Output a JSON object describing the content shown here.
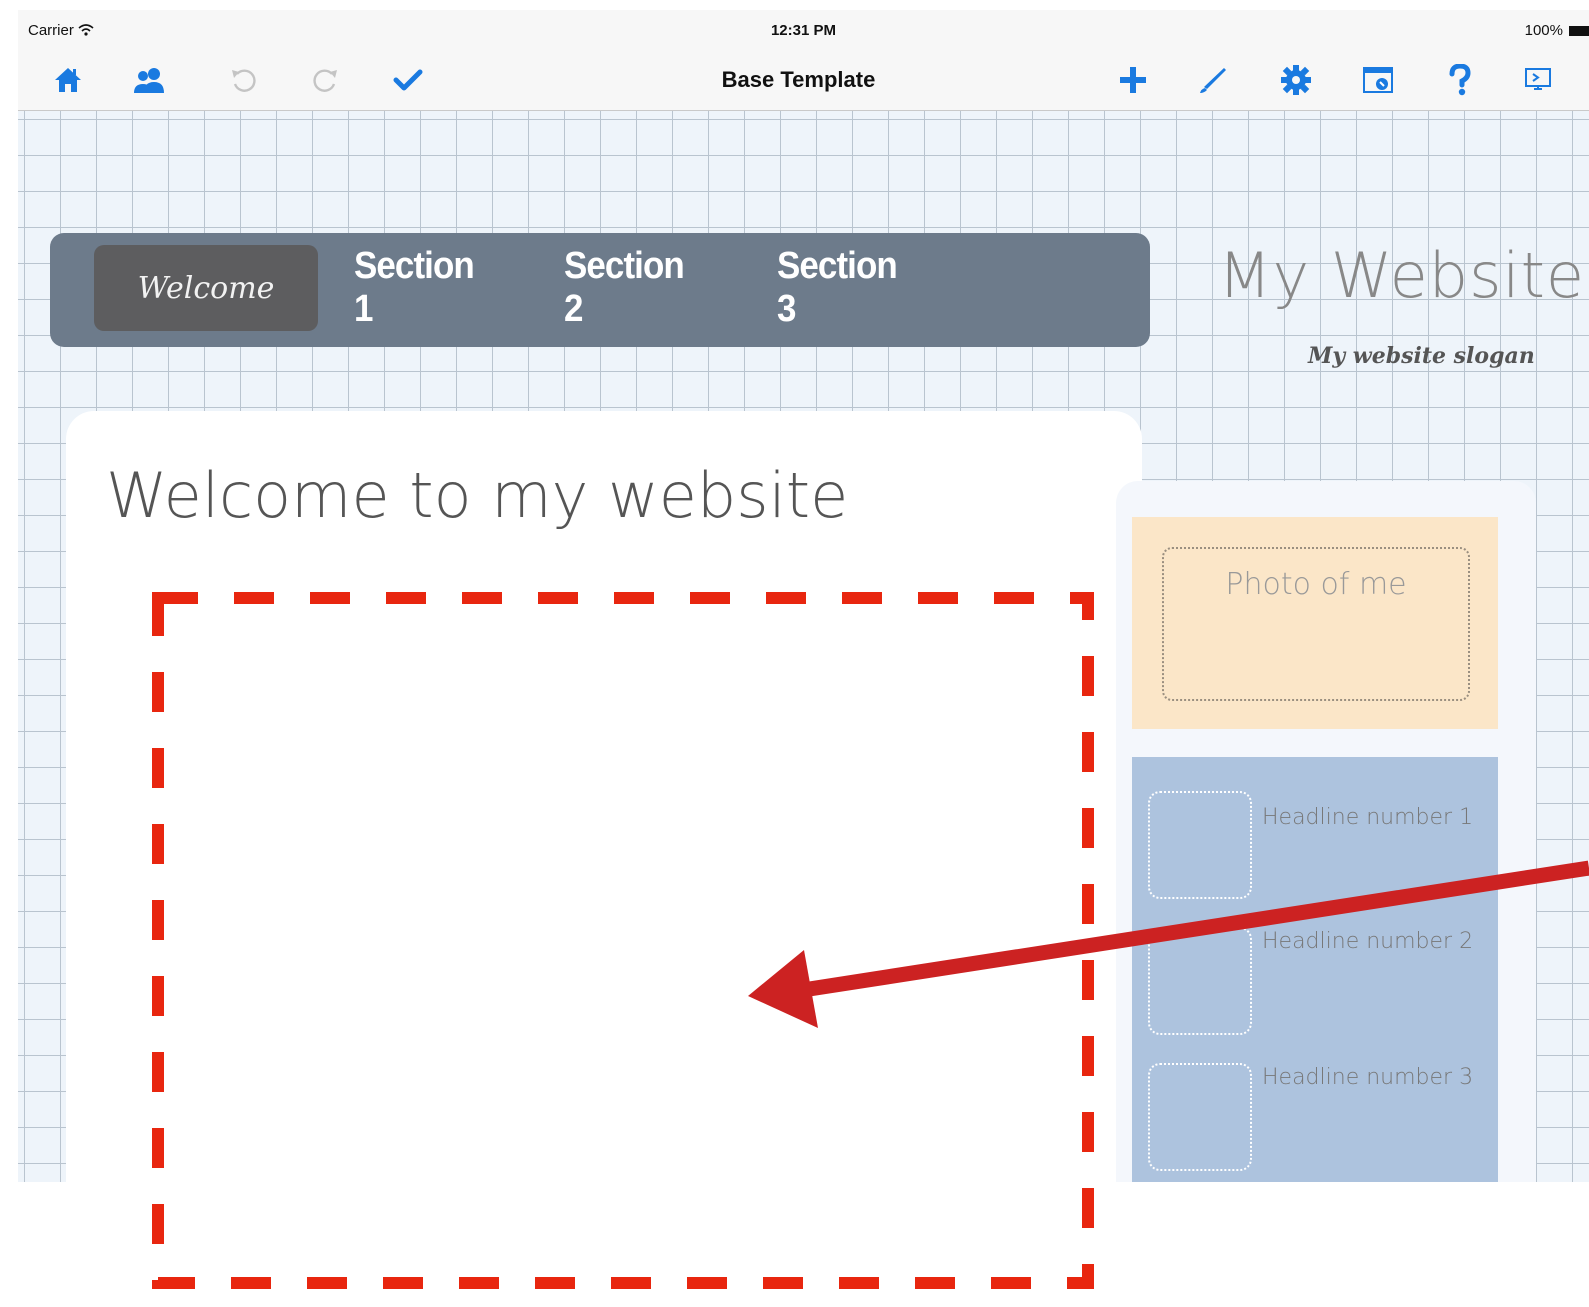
{
  "status_bar": {
    "carrier": "Carrier",
    "time": "12:31 PM",
    "battery": "100%"
  },
  "toolbar": {
    "title": "Base Template",
    "left_icons": [
      "home-icon",
      "users-icon",
      "undo-icon",
      "redo-icon",
      "checkmark-icon"
    ],
    "right_icons": [
      "plus-icon",
      "brush-icon",
      "gear-icon",
      "preview-window-icon",
      "help-icon",
      "presentation-icon"
    ]
  },
  "site": {
    "nav": {
      "active": "Welcome",
      "items": [
        "Section 1",
        "Section 2",
        "Section 3"
      ]
    },
    "title": "My Website",
    "slogan": "My website slogan",
    "main_heading": "Welcome to my website",
    "photo_label": "Photo of me",
    "headlines": [
      "Headline number 1",
      "Headline number 2",
      "Headline number 3"
    ]
  },
  "colors": {
    "accent": "#1a7ae0",
    "nav_bar": "#6d7b8b",
    "photo_box": "#fbe6c8",
    "news_box": "#adc3de",
    "annotation_red": "#e8260f",
    "arrow_red": "#cc2222"
  }
}
